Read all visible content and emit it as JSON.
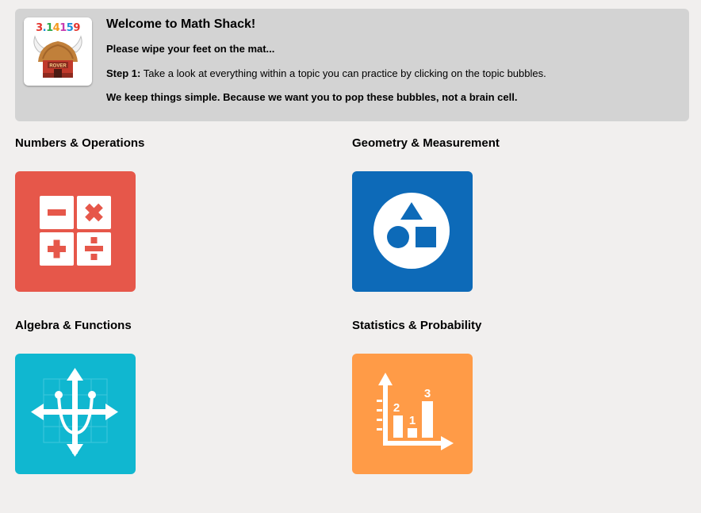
{
  "banner": {
    "title": "Welcome to Math Shack!",
    "subtitle": "Please wipe your feet on the mat...",
    "step_label": "Step 1:",
    "step_text": " Take a look at everything within a topic you can practice by clicking on the topic bubbles.",
    "tagline": "We keep things simple. Because we want you to pop these bubbles, not a brain cell.",
    "logo": {
      "digits": [
        "3",
        ".",
        "1",
        "4",
        "1",
        "5",
        "9"
      ],
      "digit_colors": [
        "#e4352d",
        "#1c8fd8",
        "#2da84a",
        "#f39a1e",
        "#c83bb0",
        "#1c8fd8",
        "#e4352d"
      ],
      "sign_text": "ROVER",
      "icon": "viking-hut-icon"
    }
  },
  "topics": [
    {
      "title": "Numbers & Operations",
      "color": "#e6574a",
      "icon": "calculator-icon"
    },
    {
      "title": "Geometry & Measurement",
      "color": "#0d6ab8",
      "icon": "shapes-icon"
    },
    {
      "title": "Algebra & Functions",
      "color": "#10b7d0",
      "icon": "graph-axes-icon"
    },
    {
      "title": "Statistics & Probability",
      "color": "#ff9b47",
      "icon": "bar-chart-icon"
    }
  ],
  "stats_icon_labels": [
    "2",
    "1",
    "3"
  ]
}
